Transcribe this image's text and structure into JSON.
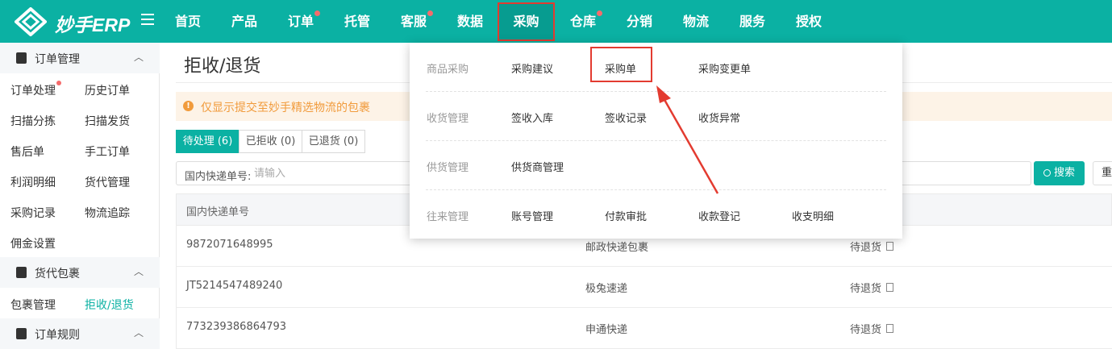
{
  "app": {
    "name": "妙手ERP"
  },
  "topnav": [
    {
      "label": "首页",
      "dot": false
    },
    {
      "label": "产品",
      "dot": false
    },
    {
      "label": "订单",
      "dot": true
    },
    {
      "label": "托管",
      "dot": false
    },
    {
      "label": "客服",
      "dot": true
    },
    {
      "label": "数据",
      "dot": false
    },
    {
      "label": "采购",
      "dot": false,
      "active": true
    },
    {
      "label": "仓库",
      "dot": true
    },
    {
      "label": "分销",
      "dot": false
    },
    {
      "label": "物流",
      "dot": false
    },
    {
      "label": "服务",
      "dot": false
    },
    {
      "label": "授权",
      "dot": false
    }
  ],
  "sidebar": {
    "sections": [
      {
        "title": "订单管理",
        "items": [
          "订单处理",
          "历史订单",
          "扫描分拣",
          "扫描发货",
          "售后单",
          "手工订单",
          "利润明细",
          "货代管理",
          "采购记录",
          "物流追踪",
          "佣金设置"
        ]
      },
      {
        "title": "货代包裹",
        "items": [
          "包裹管理",
          "拒收/退货"
        ]
      },
      {
        "title": "订单规则",
        "items": []
      }
    ]
  },
  "page": {
    "title": "拒收/退货",
    "alert": "仅显示提交至妙手精选物流的包裹",
    "tabs": [
      "待处理 (6)",
      "已拒收 (0)",
      "已退货 (0)"
    ],
    "filter": {
      "label": "国内快递单号:",
      "placeholder": "请输入"
    },
    "search_label": "搜索",
    "reset_label": "重",
    "table": {
      "header": "国内快递单号",
      "rows": [
        {
          "tracking": "9872071648995",
          "carrier": "邮政快递包裹",
          "status": "待退货"
        },
        {
          "tracking": "JT5214547489240",
          "carrier": "极兔速递",
          "status": "待退货"
        },
        {
          "tracking": "773239386864793",
          "carrier": "申通快递",
          "status": "待退货"
        }
      ]
    }
  },
  "dropdown": {
    "groups": [
      {
        "label": "商品采购",
        "items": [
          "采购建议",
          "采购单",
          "采购变更单"
        ]
      },
      {
        "label": "收货管理",
        "items": [
          "签收入库",
          "签收记录",
          "收货异常"
        ]
      },
      {
        "label": "供货管理",
        "items": [
          "供货商管理"
        ]
      },
      {
        "label": "往来管理",
        "items": [
          "账号管理",
          "付款审批",
          "收款登记",
          "收支明细"
        ]
      }
    ]
  },
  "colors": {
    "accent": "#0bb1a3",
    "highlight": "#e33b30",
    "badge": "#f56c6c",
    "warning": "#f19b3c"
  }
}
